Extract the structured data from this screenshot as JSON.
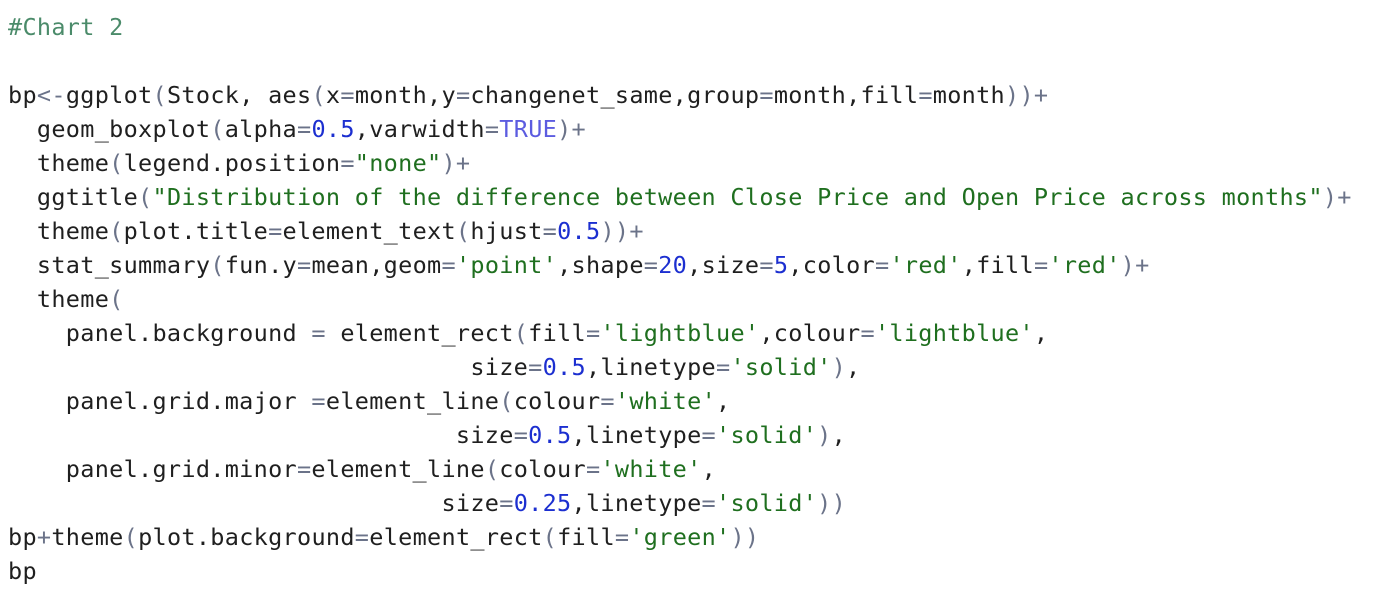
{
  "editor": {
    "colors": {
      "comment": "#4b8b6a",
      "operator": "#6b7389",
      "number": "#1c2fd0",
      "string": "#1f6f1f",
      "constant": "#5c5ce0",
      "text": "#1f1f1f"
    },
    "lines": [
      {
        "tokens": [
          {
            "t": "c",
            "v": "#Chart 2"
          }
        ]
      },
      {
        "tokens": []
      },
      {
        "tokens": [
          {
            "t": "p",
            "v": "bp"
          },
          {
            "t": "o",
            "v": "<-"
          },
          {
            "t": "p",
            "v": "ggplot"
          },
          {
            "t": "o",
            "v": "("
          },
          {
            "t": "p",
            "v": "Stock, aes"
          },
          {
            "t": "o",
            "v": "("
          },
          {
            "t": "p",
            "v": "x"
          },
          {
            "t": "o",
            "v": "="
          },
          {
            "t": "p",
            "v": "month,y"
          },
          {
            "t": "o",
            "v": "="
          },
          {
            "t": "p",
            "v": "changenet_same,group"
          },
          {
            "t": "o",
            "v": "="
          },
          {
            "t": "p",
            "v": "month,fill"
          },
          {
            "t": "o",
            "v": "="
          },
          {
            "t": "p",
            "v": "month"
          },
          {
            "t": "o",
            "v": "))+"
          }
        ]
      },
      {
        "tokens": [
          {
            "t": "p",
            "v": "  geom_boxplot"
          },
          {
            "t": "o",
            "v": "("
          },
          {
            "t": "p",
            "v": "alpha"
          },
          {
            "t": "o",
            "v": "="
          },
          {
            "t": "n",
            "v": "0.5"
          },
          {
            "t": "p",
            "v": ",varwidth"
          },
          {
            "t": "o",
            "v": "="
          },
          {
            "t": "k",
            "v": "TRUE"
          },
          {
            "t": "o",
            "v": ")+"
          }
        ]
      },
      {
        "tokens": [
          {
            "t": "p",
            "v": "  theme"
          },
          {
            "t": "o",
            "v": "("
          },
          {
            "t": "p",
            "v": "legend.position"
          },
          {
            "t": "o",
            "v": "="
          },
          {
            "t": "s",
            "v": "\"none\""
          },
          {
            "t": "o",
            "v": ")+"
          }
        ]
      },
      {
        "tokens": [
          {
            "t": "p",
            "v": "  ggtitle"
          },
          {
            "t": "o",
            "v": "("
          },
          {
            "t": "s",
            "v": "\"Distribution of the difference between Close Price and Open Price across months\""
          },
          {
            "t": "o",
            "v": ")+"
          }
        ]
      },
      {
        "tokens": [
          {
            "t": "p",
            "v": "  theme"
          },
          {
            "t": "o",
            "v": "("
          },
          {
            "t": "p",
            "v": "plot.title"
          },
          {
            "t": "o",
            "v": "="
          },
          {
            "t": "p",
            "v": "element_text"
          },
          {
            "t": "o",
            "v": "("
          },
          {
            "t": "p",
            "v": "hjust"
          },
          {
            "t": "o",
            "v": "="
          },
          {
            "t": "n",
            "v": "0.5"
          },
          {
            "t": "o",
            "v": "))+"
          }
        ]
      },
      {
        "tokens": [
          {
            "t": "p",
            "v": "  stat_summary"
          },
          {
            "t": "o",
            "v": "("
          },
          {
            "t": "p",
            "v": "fun.y"
          },
          {
            "t": "o",
            "v": "="
          },
          {
            "t": "p",
            "v": "mean,geom"
          },
          {
            "t": "o",
            "v": "="
          },
          {
            "t": "s",
            "v": "'point'"
          },
          {
            "t": "p",
            "v": ",shape"
          },
          {
            "t": "o",
            "v": "="
          },
          {
            "t": "n",
            "v": "20"
          },
          {
            "t": "p",
            "v": ",size"
          },
          {
            "t": "o",
            "v": "="
          },
          {
            "t": "n",
            "v": "5"
          },
          {
            "t": "p",
            "v": ",color"
          },
          {
            "t": "o",
            "v": "="
          },
          {
            "t": "s",
            "v": "'red'"
          },
          {
            "t": "p",
            "v": ",fill"
          },
          {
            "t": "o",
            "v": "="
          },
          {
            "t": "s",
            "v": "'red'"
          },
          {
            "t": "o",
            "v": ")+"
          }
        ]
      },
      {
        "tokens": [
          {
            "t": "p",
            "v": "  theme"
          },
          {
            "t": "o",
            "v": "("
          }
        ]
      },
      {
        "tokens": [
          {
            "t": "p",
            "v": "    panel.background "
          },
          {
            "t": "o",
            "v": "="
          },
          {
            "t": "p",
            "v": " element_rect"
          },
          {
            "t": "o",
            "v": "("
          },
          {
            "t": "p",
            "v": "fill"
          },
          {
            "t": "o",
            "v": "="
          },
          {
            "t": "s",
            "v": "'lightblue'"
          },
          {
            "t": "p",
            "v": ",colour"
          },
          {
            "t": "o",
            "v": "="
          },
          {
            "t": "s",
            "v": "'lightblue'"
          },
          {
            "t": "p",
            "v": ","
          }
        ]
      },
      {
        "tokens": [
          {
            "t": "p",
            "v": "                                size"
          },
          {
            "t": "o",
            "v": "="
          },
          {
            "t": "n",
            "v": "0.5"
          },
          {
            "t": "p",
            "v": ",linetype"
          },
          {
            "t": "o",
            "v": "="
          },
          {
            "t": "s",
            "v": "'solid'"
          },
          {
            "t": "o",
            "v": ")"
          },
          {
            "t": "p",
            "v": ","
          }
        ]
      },
      {
        "tokens": [
          {
            "t": "p",
            "v": "    panel.grid.major "
          },
          {
            "t": "o",
            "v": "="
          },
          {
            "t": "p",
            "v": "element_line"
          },
          {
            "t": "o",
            "v": "("
          },
          {
            "t": "p",
            "v": "colour"
          },
          {
            "t": "o",
            "v": "="
          },
          {
            "t": "s",
            "v": "'white'"
          },
          {
            "t": "p",
            "v": ","
          }
        ]
      },
      {
        "tokens": [
          {
            "t": "p",
            "v": "                               size"
          },
          {
            "t": "o",
            "v": "="
          },
          {
            "t": "n",
            "v": "0.5"
          },
          {
            "t": "p",
            "v": ",linetype"
          },
          {
            "t": "o",
            "v": "="
          },
          {
            "t": "s",
            "v": "'solid'"
          },
          {
            "t": "o",
            "v": ")"
          },
          {
            "t": "p",
            "v": ","
          }
        ]
      },
      {
        "tokens": [
          {
            "t": "p",
            "v": "    panel.grid.minor"
          },
          {
            "t": "o",
            "v": "="
          },
          {
            "t": "p",
            "v": "element_line"
          },
          {
            "t": "o",
            "v": "("
          },
          {
            "t": "p",
            "v": "colour"
          },
          {
            "t": "o",
            "v": "="
          },
          {
            "t": "s",
            "v": "'white'"
          },
          {
            "t": "p",
            "v": ","
          }
        ]
      },
      {
        "tokens": [
          {
            "t": "p",
            "v": "                              size"
          },
          {
            "t": "o",
            "v": "="
          },
          {
            "t": "n",
            "v": "0.25"
          },
          {
            "t": "p",
            "v": ",linetype"
          },
          {
            "t": "o",
            "v": "="
          },
          {
            "t": "s",
            "v": "'solid'"
          },
          {
            "t": "o",
            "v": "))"
          }
        ]
      },
      {
        "tokens": [
          {
            "t": "p",
            "v": "bp"
          },
          {
            "t": "o",
            "v": "+"
          },
          {
            "t": "p",
            "v": "theme"
          },
          {
            "t": "o",
            "v": "("
          },
          {
            "t": "p",
            "v": "plot.background"
          },
          {
            "t": "o",
            "v": "="
          },
          {
            "t": "p",
            "v": "element_rect"
          },
          {
            "t": "o",
            "v": "("
          },
          {
            "t": "p",
            "v": "fill"
          },
          {
            "t": "o",
            "v": "="
          },
          {
            "t": "s",
            "v": "'green'"
          },
          {
            "t": "o",
            "v": "))"
          }
        ]
      },
      {
        "tokens": [
          {
            "t": "p",
            "v": "bp"
          }
        ]
      }
    ]
  }
}
